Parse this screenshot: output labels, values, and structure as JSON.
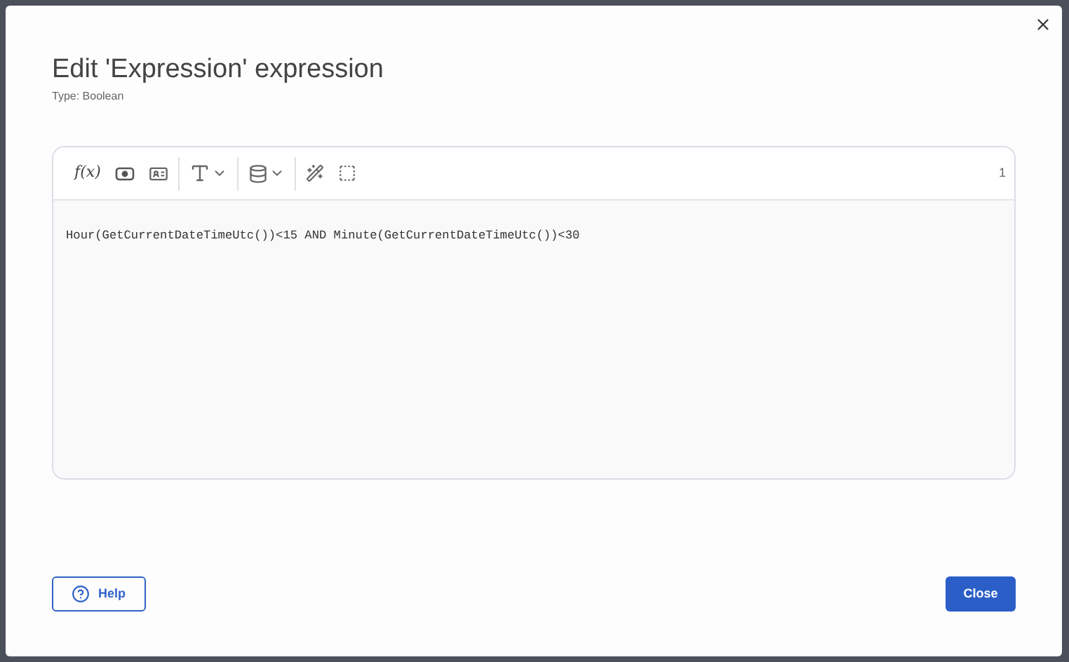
{
  "dialog": {
    "title": "Edit 'Expression' expression",
    "subtitle": "Type: Boolean"
  },
  "toolbar": [
    {
      "tools": [
        {
          "kind": "function",
          "label": "f(x)"
        },
        {
          "kind": "preview"
        },
        {
          "kind": "card"
        }
      ]
    },
    {
      "tools": [
        {
          "kind": "font",
          "dropdown": true
        }
      ]
    },
    {
      "tools": [
        {
          "kind": "database",
          "dropdown": true
        }
      ]
    },
    {
      "tools": [
        {
          "kind": "wand"
        },
        {
          "kind": "select"
        }
      ]
    }
  ],
  "editor": {
    "line_count": "1",
    "code": "Hour(GetCurrentDateTimeUtc())<15 AND Minute(GetCurrentDateTimeUtc())<30"
  },
  "buttons": {
    "help": "Help",
    "close": "Close"
  }
}
